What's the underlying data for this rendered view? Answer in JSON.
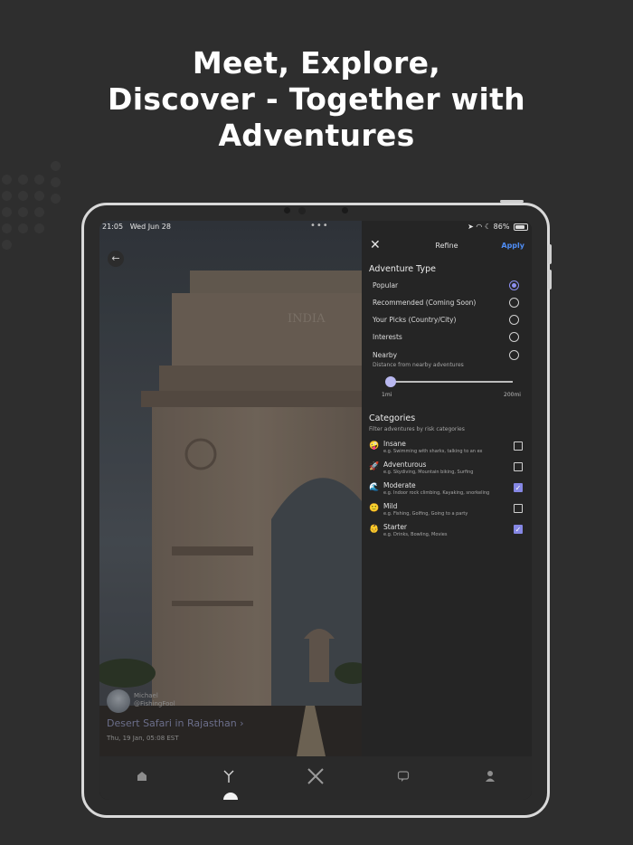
{
  "headline": {
    "line1": "Meet, Explore,",
    "line2": "Discover - Together with",
    "line3": "Adventures"
  },
  "status_bar": {
    "time": "21:05",
    "date": "Wed Jun 28",
    "battery": "86%"
  },
  "adventure": {
    "author_name": "Michael",
    "author_handle": "@FishingFool",
    "title": "Desert Safari in Rajasthan",
    "title_chevron": "›",
    "date": "Thu, 19 Jan, 05:08 EST",
    "monument_inscription": "INDIA"
  },
  "refine": {
    "title": "Refine",
    "apply_label": "Apply",
    "adventure_type_heading": "Adventure Type",
    "options": [
      {
        "label": "Popular",
        "selected": true
      },
      {
        "label": "Recommended (Coming Soon)",
        "selected": false
      },
      {
        "label": "Your Picks (Country/City)",
        "selected": false
      },
      {
        "label": "Interests",
        "selected": false
      },
      {
        "label": "Nearby",
        "selected": false
      }
    ],
    "nearby_hint": "Distance from nearby adventures",
    "slider": {
      "min_label": "1mi",
      "max_label": "200mi",
      "value_fraction": 0.0
    },
    "categories_heading": "Categories",
    "categories_hint": "Filter adventures by risk categories",
    "categories": [
      {
        "icon": "crazy-face-icon",
        "emoji": "🤪",
        "title": "Insane",
        "desc": "e.g. Swimming with sharks, talking to an ex",
        "checked": false
      },
      {
        "icon": "rocket-icon",
        "emoji": "🚀",
        "title": "Adventurous",
        "desc": "e.g. Skydiving, Mountain biking, Surfing",
        "checked": false
      },
      {
        "icon": "wave-icon",
        "emoji": "🌊",
        "title": "Moderate",
        "desc": "e.g. Indoor rock climbing, Kayaking, snorkeling",
        "checked": true
      },
      {
        "icon": "slight-smile-icon",
        "emoji": "🙂",
        "title": "Mild",
        "desc": "e.g. Fishing, Golfing, Going to a party",
        "checked": false
      },
      {
        "icon": "baby-icon",
        "emoji": "👶",
        "title": "Starter",
        "desc": "e.g. Drinks, Bowling, Movies",
        "checked": true
      }
    ]
  },
  "tabbar": {
    "active_tab": "explore",
    "tabs": [
      {
        "id": "home",
        "icon": "home-icon"
      },
      {
        "id": "explore",
        "icon": "branch-icon"
      },
      {
        "id": "create",
        "icon": "cross-icon"
      },
      {
        "id": "messages",
        "icon": "chat-icon"
      },
      {
        "id": "profile",
        "icon": "person-icon"
      }
    ]
  },
  "colors": {
    "background": "#2e2e2e",
    "accent": "#8587e4",
    "apply": "#4f8df5",
    "panel": "#252525"
  }
}
